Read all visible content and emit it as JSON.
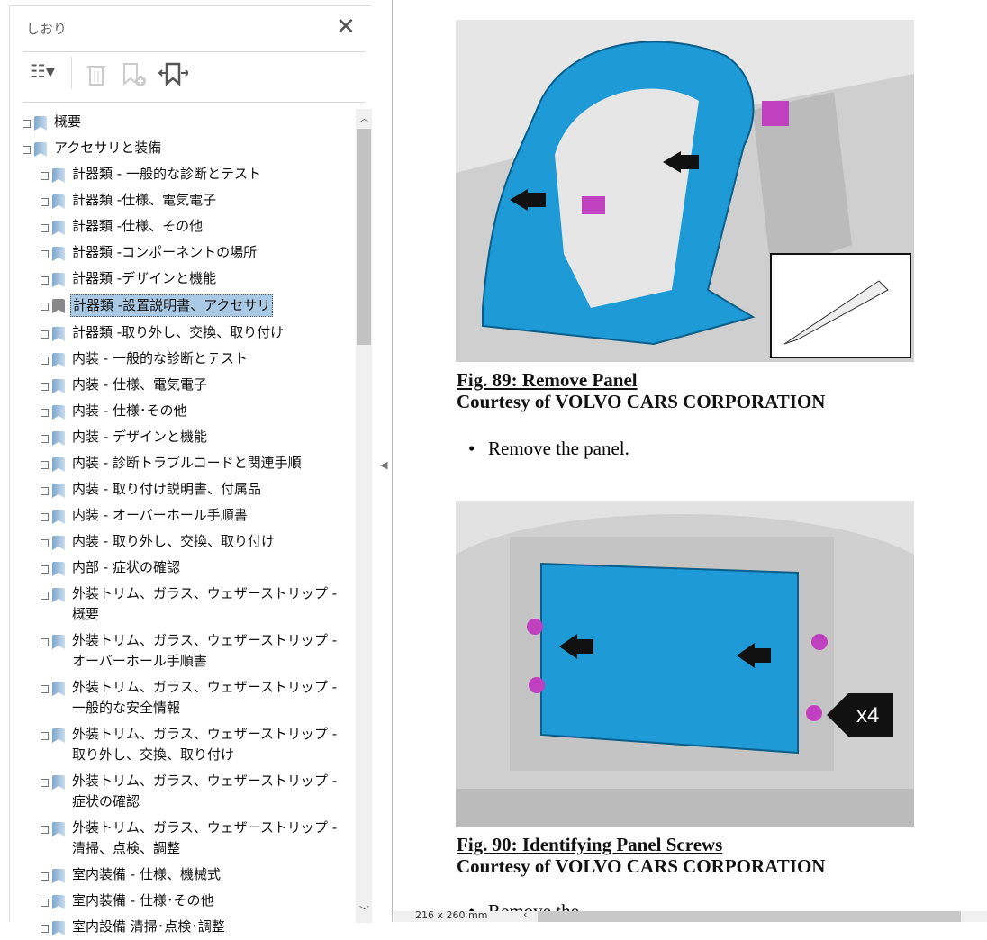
{
  "panel": {
    "title": "しおり",
    "close": "✕",
    "options_icon": "☷▾",
    "delete_icon": "🗑",
    "new_bookmark_icon": "bookmark-add",
    "expand_icon": "bookmark-expand"
  },
  "bookmarks": [
    {
      "label": "概要",
      "level": 0
    },
    {
      "label": "アクセサリと装備",
      "level": 0
    },
    {
      "label": "計器類 - 一般的な診断とテスト",
      "level": 1
    },
    {
      "label": "計器類 -仕様、電気電子",
      "level": 1
    },
    {
      "label": "計器類 -仕様、その他",
      "level": 1
    },
    {
      "label": "計器類 -コンポーネントの場所",
      "level": 1
    },
    {
      "label": "計器類 -デザインと機能",
      "level": 1
    },
    {
      "label": "計器類 -設置説明書、アクセサリ",
      "level": 1,
      "selected": true
    },
    {
      "label": "計器類 -取り外し、交換、取り付け",
      "level": 1
    },
    {
      "label": "内装 - 一般的な診断とテスト",
      "level": 1
    },
    {
      "label": "内装 - 仕様、電気電子",
      "level": 1
    },
    {
      "label": "内装 - 仕様･その他",
      "level": 1
    },
    {
      "label": "内装 - デザインと機能",
      "level": 1
    },
    {
      "label": "内装 - 診断トラブルコードと関連手順",
      "level": 1
    },
    {
      "label": "内装 - 取り付け説明書、付属品",
      "level": 1
    },
    {
      "label": "内装 - オーバーホール手順書",
      "level": 1
    },
    {
      "label": "内装 - 取り外し、交換、取り付け",
      "level": 1
    },
    {
      "label": "内部 - 症状の確認",
      "level": 1
    },
    {
      "label": "外装トリム、ガラス、ウェザーストリップ - 概要",
      "level": 1
    },
    {
      "label": "外装トリム、ガラス、ウェザーストリップ - オーバーホール手順書",
      "level": 1
    },
    {
      "label": "外装トリム、ガラス、ウェザーストリップ - 一般的な安全情報",
      "level": 1
    },
    {
      "label": "外装トリム、ガラス、ウェザーストリップ - 取り外し、交換、取り付け",
      "level": 1
    },
    {
      "label": "外装トリム、ガラス、ウェザーストリップ - 症状の確認",
      "level": 1
    },
    {
      "label": "外装トリム、ガラス、ウェザーストリップ - 清掃、点検、調整",
      "level": 1
    },
    {
      "label": "室内装備 - 仕様、機械式",
      "level": 1
    },
    {
      "label": "室内装備 - 仕様･その他",
      "level": 1
    },
    {
      "label": "室内設備 清掃･点検･調整",
      "level": 1
    }
  ],
  "document": {
    "fig89_title": "Fig. 89: Remove Panel",
    "fig89_credit": "Courtesy of VOLVO CARS CORPORATION",
    "bullet1": "Remove the panel.",
    "fig90_title": "Fig. 90: Identifying Panel Screws",
    "fig90_credit": "Courtesy of VOLVO CARS CORPORATION",
    "fig90_callout": "x4",
    "next_text": "Remove the"
  },
  "status": {
    "page_size": "216 x 260 mm"
  },
  "colors": {
    "part_blue": "#1e9ad6",
    "screw_magenta": "#c040c0",
    "selection": "#a9c9e4"
  }
}
